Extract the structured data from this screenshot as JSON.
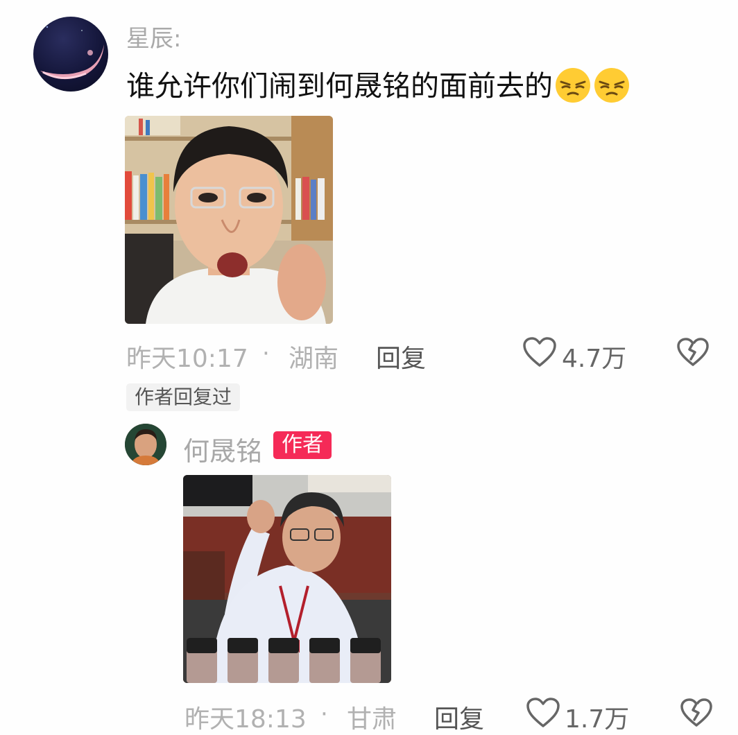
{
  "main_comment": {
    "username": "星辰:",
    "text": "谁允许你们闹到何晟铭的面前去的",
    "emojis": [
      "smirk-face-icon",
      "smirk-face-icon"
    ],
    "time": "昨天10:17",
    "separator": "·",
    "location": "湖南",
    "reply_label": "回复",
    "like_count": "4.7万",
    "author_replied_tag": "作者回复过"
  },
  "reply": {
    "username": "何晟铭",
    "badge": "作者",
    "time": "昨天18:13",
    "separator": "·",
    "location": "甘肃",
    "reply_label": "回复",
    "like_count": "1.7万"
  },
  "colors": {
    "meta_gray": "#b1b1b1",
    "author_badge": "#f52a57",
    "text_dark": "#111111"
  }
}
